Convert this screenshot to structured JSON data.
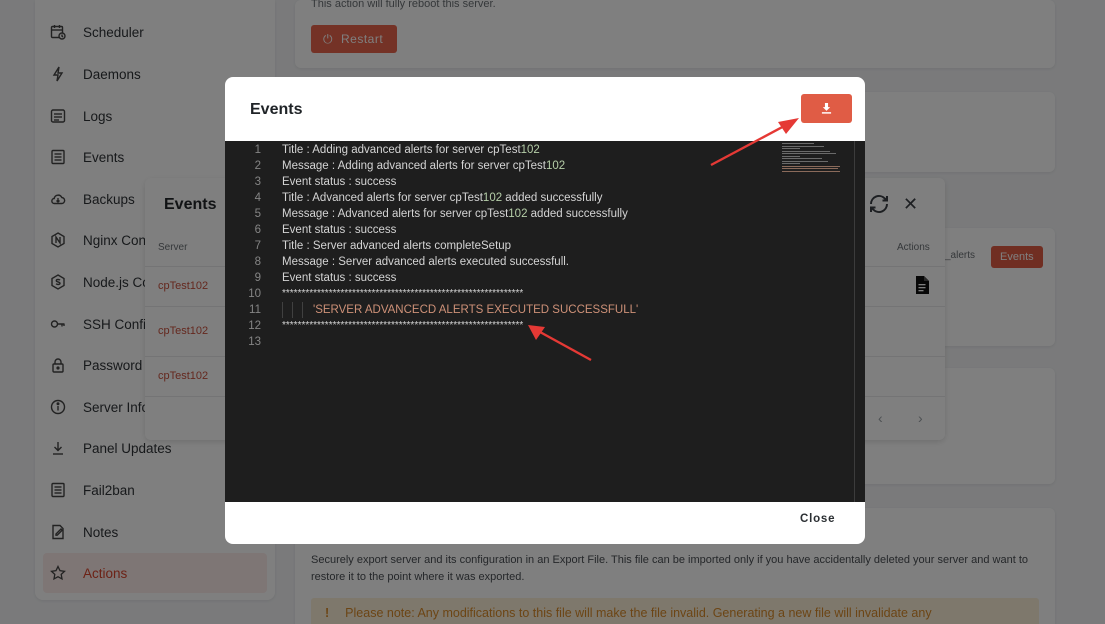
{
  "sidebar": {
    "items": [
      {
        "label": "Scheduler",
        "icon": "calendar-clock-icon"
      },
      {
        "label": "Daemons",
        "icon": "lightning-icon"
      },
      {
        "label": "Logs",
        "icon": "logs-icon"
      },
      {
        "label": "Events",
        "icon": "list-icon"
      },
      {
        "label": "Backups",
        "icon": "cloud-icon"
      },
      {
        "label": "Nginx Conf",
        "icon": "nginx-icon"
      },
      {
        "label": "Node.js Co",
        "icon": "nodejs-icon"
      },
      {
        "label": "SSH Config",
        "icon": "key-icon"
      },
      {
        "label": "Password I",
        "icon": "lock-icon"
      },
      {
        "label": "Server Info",
        "icon": "info-icon"
      },
      {
        "label": "Panel Updates",
        "icon": "download-icon"
      },
      {
        "label": "Fail2ban",
        "icon": "list-icon"
      },
      {
        "label": "Notes",
        "icon": "notes-icon"
      },
      {
        "label": "Actions",
        "icon": "star-icon"
      }
    ]
  },
  "main": {
    "restart_desc": "This action will fully reboot this server.",
    "restart_label": "Restart",
    "alerts_label": "_alerts",
    "events_button": "Events",
    "export_desc": "Securely export server and its configuration in an Export File. This file can be imported only if you have accidentally deleted your server and want to restore it to the point where it was exported.",
    "notice": "Please note: Any modifications to this file will make the file invalid. Generating a new file will invalidate any"
  },
  "events_panel": {
    "title": "Events",
    "col_server": "Server",
    "col_actions": "Actions",
    "rows": [
      "cpTest102",
      "cpTest102",
      "cpTest102"
    ]
  },
  "modal": {
    "title": "Events",
    "close_label": "Close",
    "lines": [
      {
        "n": "1",
        "pre": "Title : Adding advanced alerts for server cpTest",
        "num": "102",
        "post": ""
      },
      {
        "n": "2",
        "pre": "Message : Adding advanced alerts for server cpTest",
        "num": "102",
        "post": ""
      },
      {
        "n": "3",
        "pre": "Event status : success",
        "num": "",
        "post": ""
      },
      {
        "n": "4",
        "pre": "Title : Advanced alerts for server cpTest",
        "num": "102",
        "post": " added successfully"
      },
      {
        "n": "5",
        "pre": "Message : Advanced alerts for server cpTest",
        "num": "102",
        "post": " added successfully"
      },
      {
        "n": "6",
        "pre": "Event status : success",
        "num": "",
        "post": ""
      },
      {
        "n": "7",
        "pre": "Title : Server advanced alerts completeSetup",
        "num": "",
        "post": ""
      },
      {
        "n": "8",
        "pre": "Message : Server advanced alerts executed successfull.",
        "num": "",
        "post": ""
      },
      {
        "n": "9",
        "pre": "Event status : success",
        "num": "",
        "post": ""
      },
      {
        "n": "10",
        "pre": "**************************************************************",
        "num": "",
        "post": ""
      },
      {
        "n": "11",
        "pre": "'SERVER ADVANCECD ALERTS EXECUTED SUCCESSFULL'",
        "num": "",
        "post": ""
      },
      {
        "n": "12",
        "pre": "**************************************************************",
        "num": "",
        "post": ""
      },
      {
        "n": "13",
        "pre": "",
        "num": "",
        "post": ""
      }
    ]
  },
  "colors": {
    "accent": "#e05c45",
    "editor_bg": "#1e1e1e",
    "number": "#b5cea8",
    "string": "#ce9178",
    "annotation": "#e53935"
  }
}
